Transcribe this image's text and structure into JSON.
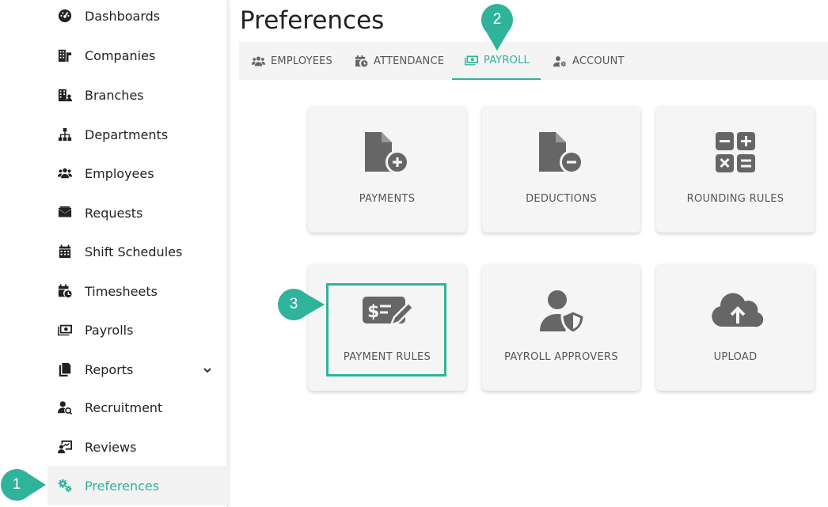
{
  "sidebar": {
    "items": [
      {
        "label": "Dashboards",
        "icon": "dashboard-icon"
      },
      {
        "label": "Companies",
        "icon": "companies-icon"
      },
      {
        "label": "Branches",
        "icon": "branches-icon"
      },
      {
        "label": "Departments",
        "icon": "departments-icon"
      },
      {
        "label": "Employees",
        "icon": "employees-icon"
      },
      {
        "label": "Requests",
        "icon": "requests-icon"
      },
      {
        "label": "Shift Schedules",
        "icon": "calendar-icon"
      },
      {
        "label": "Timesheets",
        "icon": "timesheets-icon"
      },
      {
        "label": "Payrolls",
        "icon": "money-icon"
      },
      {
        "label": "Reports",
        "icon": "reports-icon"
      },
      {
        "label": "Recruitment",
        "icon": "recruitment-icon"
      },
      {
        "label": "Reviews",
        "icon": "reviews-icon"
      },
      {
        "label": "Preferences",
        "icon": "gears-icon"
      }
    ],
    "active_item": "Preferences"
  },
  "header": {
    "title": "Preferences"
  },
  "tabs": [
    {
      "label": "EMPLOYEES",
      "icon": "users-icon"
    },
    {
      "label": "ATTENDANCE",
      "icon": "calendar-clock-icon"
    },
    {
      "label": "PAYROLL",
      "icon": "money-icon"
    },
    {
      "label": "ACCOUNT",
      "icon": "user-gear-icon"
    }
  ],
  "active_tab": "PAYROLL",
  "cards": [
    {
      "label": "PAYMENTS",
      "icon": "file-plus-icon"
    },
    {
      "label": "DEDUCTIONS",
      "icon": "file-minus-icon"
    },
    {
      "label": "ROUNDING RULES",
      "icon": "calculator-icon"
    },
    {
      "label": "PAYMENT RULES",
      "icon": "money-check-pen-icon"
    },
    {
      "label": "PAYROLL APPROVERS",
      "icon": "user-shield-icon"
    },
    {
      "label": "UPLOAD",
      "icon": "cloud-upload-icon"
    }
  ],
  "callouts": [
    "1",
    "2",
    "3"
  ],
  "colors": {
    "accent": "#2fb39a",
    "card_bg": "#f5f5f5",
    "icon_gray": "#666666",
    "text": "#222222"
  }
}
